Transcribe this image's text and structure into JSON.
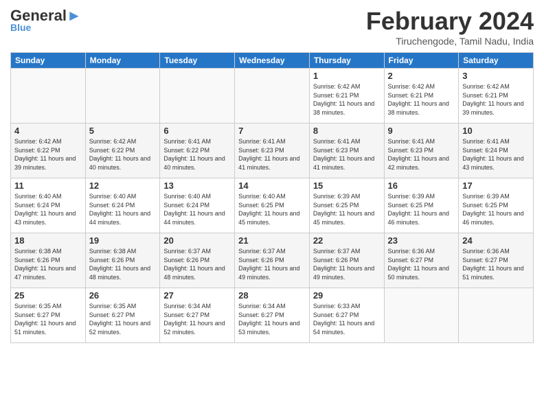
{
  "header": {
    "logo_general": "General",
    "logo_blue": "Blue",
    "month_title": "February 2024",
    "location": "Tiruchengode, Tamil Nadu, India"
  },
  "weekdays": [
    "Sunday",
    "Monday",
    "Tuesday",
    "Wednesday",
    "Thursday",
    "Friday",
    "Saturday"
  ],
  "weeks": [
    [
      {
        "day": "",
        "sunrise": "",
        "sunset": "",
        "daylight": ""
      },
      {
        "day": "",
        "sunrise": "",
        "sunset": "",
        "daylight": ""
      },
      {
        "day": "",
        "sunrise": "",
        "sunset": "",
        "daylight": ""
      },
      {
        "day": "",
        "sunrise": "",
        "sunset": "",
        "daylight": ""
      },
      {
        "day": "1",
        "sunrise": "Sunrise: 6:42 AM",
        "sunset": "Sunset: 6:21 PM",
        "daylight": "Daylight: 11 hours and 38 minutes."
      },
      {
        "day": "2",
        "sunrise": "Sunrise: 6:42 AM",
        "sunset": "Sunset: 6:21 PM",
        "daylight": "Daylight: 11 hours and 38 minutes."
      },
      {
        "day": "3",
        "sunrise": "Sunrise: 6:42 AM",
        "sunset": "Sunset: 6:21 PM",
        "daylight": "Daylight: 11 hours and 39 minutes."
      }
    ],
    [
      {
        "day": "4",
        "sunrise": "Sunrise: 6:42 AM",
        "sunset": "Sunset: 6:22 PM",
        "daylight": "Daylight: 11 hours and 39 minutes."
      },
      {
        "day": "5",
        "sunrise": "Sunrise: 6:42 AM",
        "sunset": "Sunset: 6:22 PM",
        "daylight": "Daylight: 11 hours and 40 minutes."
      },
      {
        "day": "6",
        "sunrise": "Sunrise: 6:41 AM",
        "sunset": "Sunset: 6:22 PM",
        "daylight": "Daylight: 11 hours and 40 minutes."
      },
      {
        "day": "7",
        "sunrise": "Sunrise: 6:41 AM",
        "sunset": "Sunset: 6:23 PM",
        "daylight": "Daylight: 11 hours and 41 minutes."
      },
      {
        "day": "8",
        "sunrise": "Sunrise: 6:41 AM",
        "sunset": "Sunset: 6:23 PM",
        "daylight": "Daylight: 11 hours and 41 minutes."
      },
      {
        "day": "9",
        "sunrise": "Sunrise: 6:41 AM",
        "sunset": "Sunset: 6:23 PM",
        "daylight": "Daylight: 11 hours and 42 minutes."
      },
      {
        "day": "10",
        "sunrise": "Sunrise: 6:41 AM",
        "sunset": "Sunset: 6:24 PM",
        "daylight": "Daylight: 11 hours and 43 minutes."
      }
    ],
    [
      {
        "day": "11",
        "sunrise": "Sunrise: 6:40 AM",
        "sunset": "Sunset: 6:24 PM",
        "daylight": "Daylight: 11 hours and 43 minutes."
      },
      {
        "day": "12",
        "sunrise": "Sunrise: 6:40 AM",
        "sunset": "Sunset: 6:24 PM",
        "daylight": "Daylight: 11 hours and 44 minutes."
      },
      {
        "day": "13",
        "sunrise": "Sunrise: 6:40 AM",
        "sunset": "Sunset: 6:24 PM",
        "daylight": "Daylight: 11 hours and 44 minutes."
      },
      {
        "day": "14",
        "sunrise": "Sunrise: 6:40 AM",
        "sunset": "Sunset: 6:25 PM",
        "daylight": "Daylight: 11 hours and 45 minutes."
      },
      {
        "day": "15",
        "sunrise": "Sunrise: 6:39 AM",
        "sunset": "Sunset: 6:25 PM",
        "daylight": "Daylight: 11 hours and 45 minutes."
      },
      {
        "day": "16",
        "sunrise": "Sunrise: 6:39 AM",
        "sunset": "Sunset: 6:25 PM",
        "daylight": "Daylight: 11 hours and 46 minutes."
      },
      {
        "day": "17",
        "sunrise": "Sunrise: 6:39 AM",
        "sunset": "Sunset: 6:25 PM",
        "daylight": "Daylight: 11 hours and 46 minutes."
      }
    ],
    [
      {
        "day": "18",
        "sunrise": "Sunrise: 6:38 AM",
        "sunset": "Sunset: 6:26 PM",
        "daylight": "Daylight: 11 hours and 47 minutes."
      },
      {
        "day": "19",
        "sunrise": "Sunrise: 6:38 AM",
        "sunset": "Sunset: 6:26 PM",
        "daylight": "Daylight: 11 hours and 48 minutes."
      },
      {
        "day": "20",
        "sunrise": "Sunrise: 6:37 AM",
        "sunset": "Sunset: 6:26 PM",
        "daylight": "Daylight: 11 hours and 48 minutes."
      },
      {
        "day": "21",
        "sunrise": "Sunrise: 6:37 AM",
        "sunset": "Sunset: 6:26 PM",
        "daylight": "Daylight: 11 hours and 49 minutes."
      },
      {
        "day": "22",
        "sunrise": "Sunrise: 6:37 AM",
        "sunset": "Sunset: 6:26 PM",
        "daylight": "Daylight: 11 hours and 49 minutes."
      },
      {
        "day": "23",
        "sunrise": "Sunrise: 6:36 AM",
        "sunset": "Sunset: 6:27 PM",
        "daylight": "Daylight: 11 hours and 50 minutes."
      },
      {
        "day": "24",
        "sunrise": "Sunrise: 6:36 AM",
        "sunset": "Sunset: 6:27 PM",
        "daylight": "Daylight: 11 hours and 51 minutes."
      }
    ],
    [
      {
        "day": "25",
        "sunrise": "Sunrise: 6:35 AM",
        "sunset": "Sunset: 6:27 PM",
        "daylight": "Daylight: 11 hours and 51 minutes."
      },
      {
        "day": "26",
        "sunrise": "Sunrise: 6:35 AM",
        "sunset": "Sunset: 6:27 PM",
        "daylight": "Daylight: 11 hours and 52 minutes."
      },
      {
        "day": "27",
        "sunrise": "Sunrise: 6:34 AM",
        "sunset": "Sunset: 6:27 PM",
        "daylight": "Daylight: 11 hours and 52 minutes."
      },
      {
        "day": "28",
        "sunrise": "Sunrise: 6:34 AM",
        "sunset": "Sunset: 6:27 PM",
        "daylight": "Daylight: 11 hours and 53 minutes."
      },
      {
        "day": "29",
        "sunrise": "Sunrise: 6:33 AM",
        "sunset": "Sunset: 6:27 PM",
        "daylight": "Daylight: 11 hours and 54 minutes."
      },
      {
        "day": "",
        "sunrise": "",
        "sunset": "",
        "daylight": ""
      },
      {
        "day": "",
        "sunrise": "",
        "sunset": "",
        "daylight": ""
      }
    ]
  ]
}
